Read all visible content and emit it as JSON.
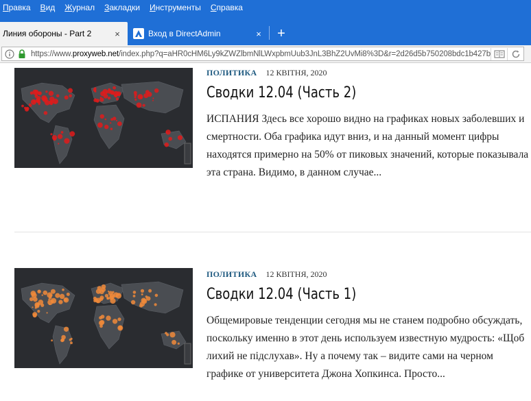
{
  "menu": [
    "Правка",
    "Вид",
    "Журнал",
    "Закладки",
    "Инструменты",
    "Справка"
  ],
  "tabs": [
    {
      "title": "Линия обороны - Part 2",
      "active": true
    },
    {
      "title": "Вход в DirectAdmin",
      "active": false
    }
  ],
  "new_tab_label": "+",
  "close_glyph": "×",
  "url": {
    "prefix": "https://www.",
    "domain": "proxyweb.net",
    "rest": "/index.php?q=aHR0cHM6Ly9kZWZlbmNlLWxpbmUub3JnL3BhZ2UvMi8%3D&r=2d26d5b750208bdc1b427b"
  },
  "articles": [
    {
      "category": "ПОЛИТИКА",
      "date": "12 КВІТНЯ, 2020",
      "title": "Сводки 12.04 (Часть 2)",
      "excerpt": "ИСПАНИЯ Здесь все хорошо видно на графиках новых заболевших и смертности. Оба графика идут вниз, и на данный момент цифры находятся примерно на 50% от пиковых значений, которые показывала эта страна. Видимо, в данном случае...",
      "dot_color": "#e01b1b"
    },
    {
      "category": "ПОЛИТИКА",
      "date": "12 КВІТНЯ, 2020",
      "title": "Сводки 12.04 (Часть 1)",
      "excerpt": "Общемировые тенденции сегодня мы не станем подробно обсуждать, поскольку именно в этот день используем известную мудрость: «Щоб лихий не підслухав». Ну а почему так – видите сами на черном графике от университета Джона Хопкинса. Просто...",
      "dot_color": "#f08a3a"
    }
  ],
  "colors": {
    "chrome_blue": "#1f6fd6",
    "category": "#1f5a80",
    "map_bg": "#2a2c30"
  }
}
